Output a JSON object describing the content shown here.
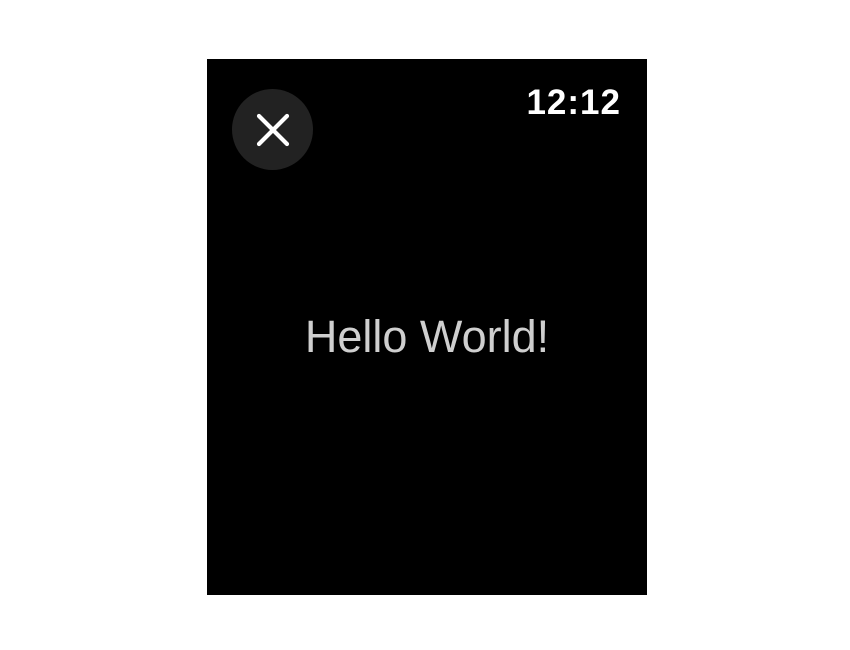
{
  "status_bar": {
    "time": "12:12"
  },
  "close_button": {
    "icon": "close-icon"
  },
  "content": {
    "message": "Hello World!"
  },
  "colors": {
    "screen_background": "#000000",
    "close_button_background": "#222222",
    "text_primary": "#ffffff",
    "text_message": "#cfcfcf"
  }
}
